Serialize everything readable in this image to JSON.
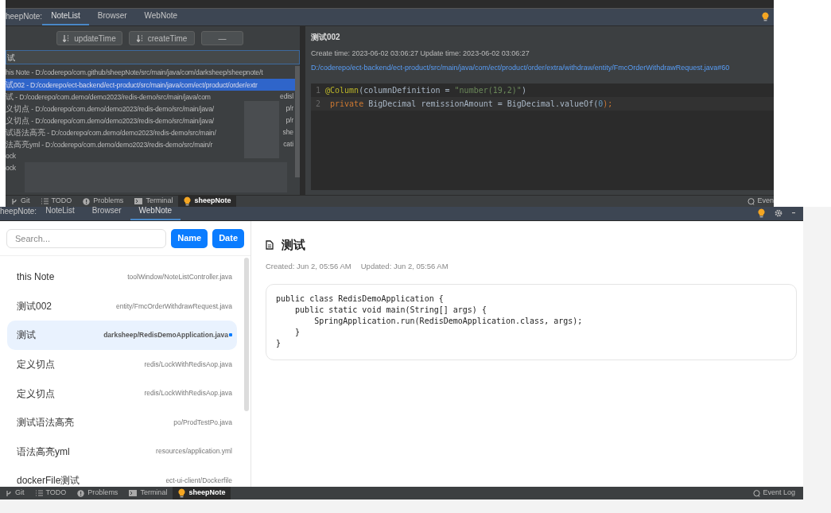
{
  "top_window": {
    "tool_tabs": {
      "label": "heepNote:",
      "tabs": [
        {
          "label": "NoteList",
          "selected": true
        },
        {
          "label": "Browser",
          "selected": false
        },
        {
          "label": "WebNote",
          "selected": false
        }
      ]
    },
    "sort_buttons": [
      {
        "label": "updateTime",
        "kind": "sort"
      },
      {
        "label": "createTime",
        "kind": "sort"
      },
      {
        "label": "—",
        "kind": "plain"
      }
    ],
    "search": {
      "value": "试"
    },
    "notes": [
      {
        "text": "his Note - D:/coderepo/com.github/sheepNote/src/main/java/com/darksheep/sheepnote/t",
        "selected": false
      },
      {
        "text": "试002 - D:/coderepo/ect-backend/ect-product/src/main/java/com/ect/product/order/extr",
        "selected": true
      },
      {
        "text": "试 - D:/coderepo/com.demo/demo2023/redis-demo/src/main/java/com",
        "tail": "edisl",
        "selected": false
      },
      {
        "text": "义切点 - D:/coderepo/com.demo/demo2023/redis-demo/src/main/java/",
        "tail": "p/r",
        "selected": false
      },
      {
        "text": "义切点 - D:/coderepo/com.demo/demo2023/redis-demo/src/main/java/",
        "tail": "p/r",
        "selected": false
      },
      {
        "text": "试语法高亮 - D:/coderepo/com.demo/demo2023/redis-demo/src/main/",
        "tail": "she",
        "selected": false
      },
      {
        "text": "法高亮yml - D:/coderepo/com.demo/demo2023/redis-demo/src/main/r",
        "tail": "cati",
        "selected": false
      },
      {
        "text": "ock",
        "selected": false
      },
      {
        "text": "ock",
        "selected": false
      }
    ],
    "detail": {
      "title": "测试002",
      "times": "Create time: 2023-06-02 03:06:27 Update time: 2023-06-02 03:06:27",
      "path": "D:/coderepo/ect-backend/ect-product/src/main/java/com/ect/product/order/extra/withdraw/entity/FmcOrderWithdrawRequest.java#60",
      "code": [
        {
          "number": "1",
          "tokens": [
            {
              "kind": "annotation",
              "text": "@Column"
            },
            {
              "kind": "plain",
              "text": "(columnDefinition = "
            },
            {
              "kind": "string",
              "text": "\"number(19,2)\""
            },
            {
              "kind": "plain",
              "text": ")"
            }
          ]
        },
        {
          "number": "2",
          "tokens": [
            {
              "kind": "keyword",
              "text": " private "
            },
            {
              "kind": "plain",
              "text": "BigDecimal remissionAmount = BigDecimal.valueOf("
            },
            {
              "kind": "number",
              "text": "0"
            },
            {
              "kind": "keyword",
              "text": ")"
            },
            {
              "kind": "keyword",
              "text": ";"
            }
          ]
        }
      ]
    },
    "status_bar": {
      "items": [
        {
          "label": "Git",
          "kind": "git",
          "selected": false
        },
        {
          "label": "TODO",
          "kind": "todo",
          "selected": false
        },
        {
          "label": "Problems",
          "kind": "problems",
          "selected": false
        },
        {
          "label": "Terminal",
          "kind": "terminal",
          "selected": false
        },
        {
          "label": "sheepNote",
          "kind": "bulb",
          "selected": true
        }
      ],
      "right": "Even"
    }
  },
  "bottom_window": {
    "tool_tabs": {
      "label": "heepNote:",
      "tabs": [
        {
          "label": "NoteList",
          "selected": false
        },
        {
          "label": "Browser",
          "selected": false
        },
        {
          "label": "WebNote",
          "selected": true
        }
      ]
    },
    "search": {
      "placeholder": "Search..."
    },
    "sort_buttons": [
      "Name",
      "Date"
    ],
    "notes": [
      {
        "title": "this Note",
        "path": "toolWindow/NoteListController.java",
        "selected": false
      },
      {
        "title": "测试002",
        "path": "entity/FmcOrderWithdrawRequest.java",
        "selected": false
      },
      {
        "title": "测试",
        "path": "darksheep/RedisDemoApplication.java",
        "selected": true
      },
      {
        "title": "定义切点",
        "path": "redis/LockWithRedisAop.java",
        "selected": false
      },
      {
        "title": "定义切点",
        "path": "redis/LockWithRedisAop.java",
        "selected": false
      },
      {
        "title": "测试语法高亮",
        "path": "po/ProdTestPo.java",
        "selected": false
      },
      {
        "title": "语法高亮yml",
        "path": "resources/application.yml",
        "selected": false
      },
      {
        "title": "dockerFile测试",
        "path": "ect-ui-client/Dockerfile",
        "selected": false
      }
    ],
    "detail": {
      "title": "测试",
      "created": "Created: Jun 2, 05:56 AM",
      "updated": "Updated: Jun 2, 05:56 AM",
      "code": [
        "public class RedisDemoApplication {",
        "    public static void main(String[] args) {",
        "        SpringApplication.run(RedisDemoApplication.class, args);",
        "    }",
        "}"
      ]
    },
    "status_bar": {
      "items": [
        {
          "label": "Git",
          "kind": "git",
          "selected": false
        },
        {
          "label": "TODO",
          "kind": "todo",
          "selected": false
        },
        {
          "label": "Problems",
          "kind": "problems",
          "selected": false
        },
        {
          "label": "Terminal",
          "kind": "terminal",
          "selected": false
        },
        {
          "label": "sheepNote",
          "kind": "bulb",
          "selected": true
        }
      ],
      "right": "Event Log"
    }
  }
}
